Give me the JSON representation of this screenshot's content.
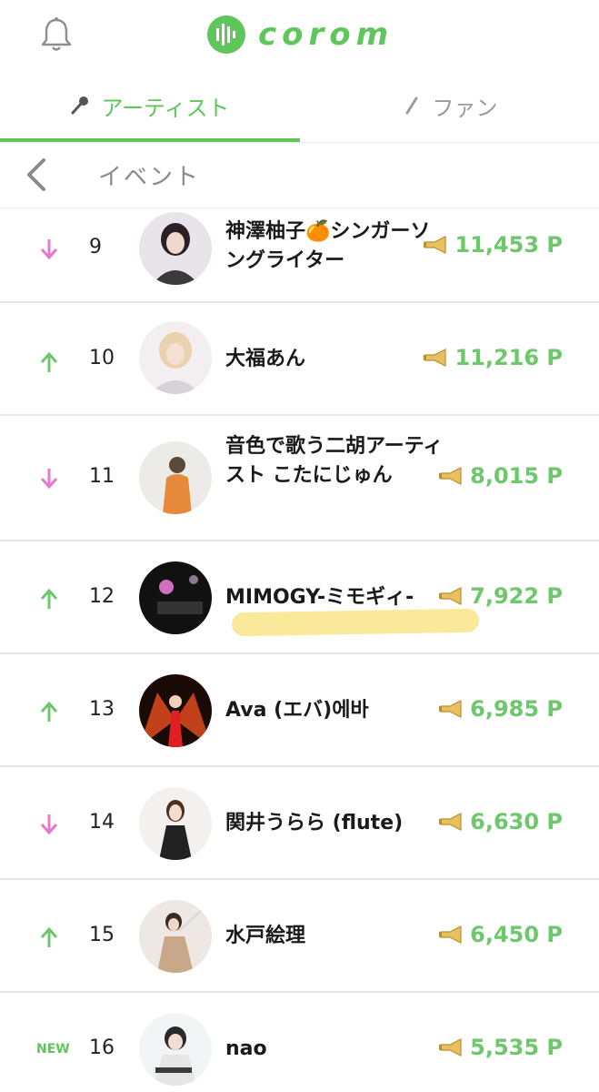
{
  "app": {
    "logo_text": "corom"
  },
  "tabs": [
    {
      "label": "アーティスト"
    },
    {
      "label": "ファン"
    }
  ],
  "nav": {
    "title": "イベント"
  },
  "ranking": [
    {
      "rank": "9",
      "trend": "down",
      "name": "神澤柚子🍊シンガーソングライター",
      "points": "11,453 P"
    },
    {
      "rank": "10",
      "trend": "up",
      "name": "大福あん",
      "points": "11,216 P"
    },
    {
      "rank": "11",
      "trend": "down",
      "name": "音色で歌う二胡アーティスト こたにじゅん",
      "points": "8,015 P"
    },
    {
      "rank": "12",
      "trend": "up",
      "name": "MIMOGY-ミモギィ-",
      "points": "7,922 P"
    },
    {
      "rank": "13",
      "trend": "up",
      "name": "Ava (エバ)에바",
      "points": "6,985 P"
    },
    {
      "rank": "14",
      "trend": "down",
      "name": "関井うらら (flute)",
      "points": "6,630 P"
    },
    {
      "rank": "15",
      "trend": "up",
      "name": "水戸絵理",
      "points": "6,450 P"
    },
    {
      "rank": "16",
      "trend": "new",
      "trend_label": "NEW",
      "name": "nao",
      "points": "5,535 P"
    }
  ],
  "colors": {
    "accent": "#5ec65a",
    "up": "#6cc86a",
    "down": "#e879c9"
  },
  "icons": {
    "bell": "bell-icon",
    "mic": "mic-icon",
    "pen": "pen-icon",
    "back": "chevron-left-icon",
    "megaphone": "megaphone-icon"
  }
}
